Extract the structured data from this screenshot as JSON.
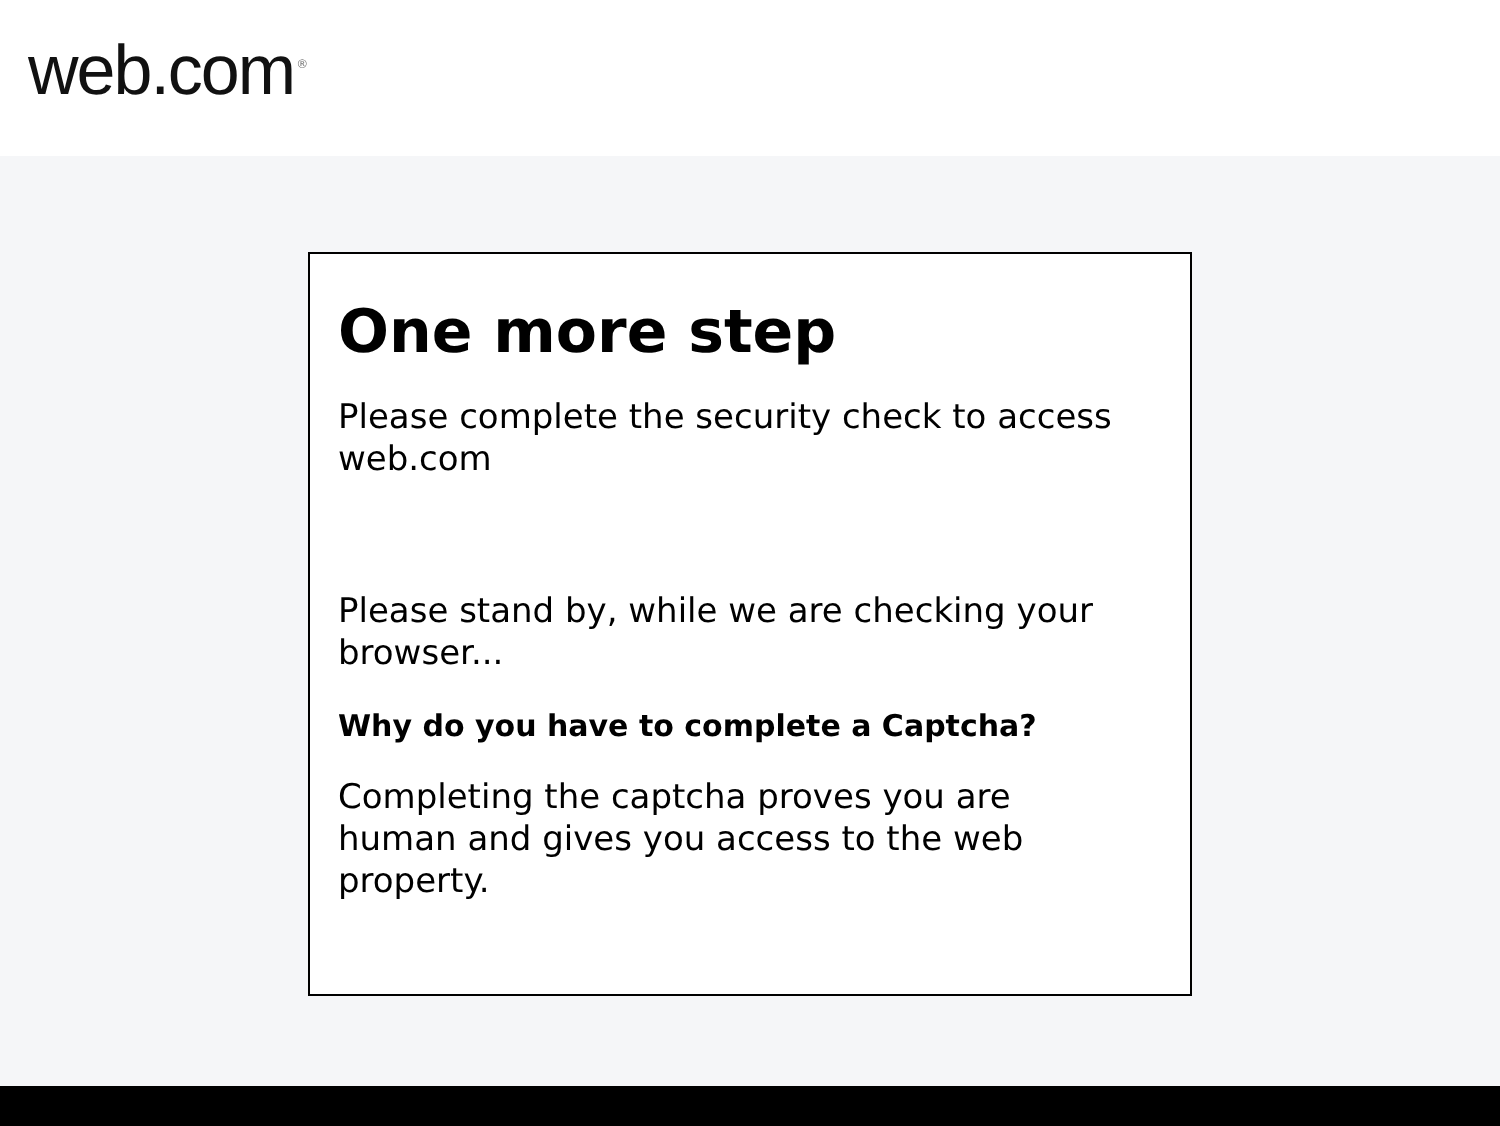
{
  "header": {
    "logo": "web.com",
    "logo_mark": "®"
  },
  "card": {
    "title": "One more step",
    "subtitle": "Please complete the security check to access web.com",
    "status": "Please stand by, while we are checking your browser...",
    "question": "Why do you have to complete a Captcha?",
    "answer": "Completing the captcha proves you are human and gives you access to the web property."
  }
}
